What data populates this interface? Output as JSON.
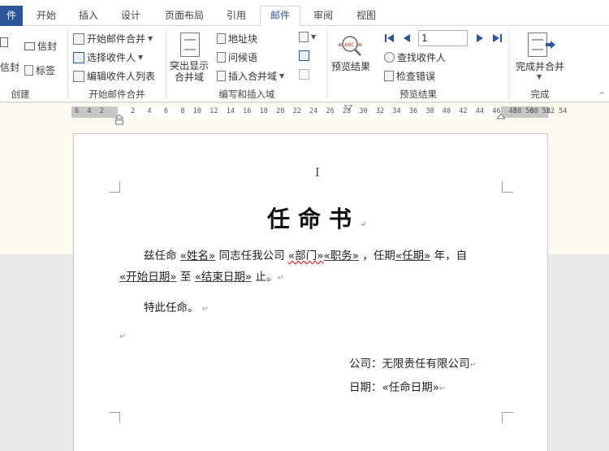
{
  "tabs": {
    "file": "件",
    "home": "开始",
    "insert": "插入",
    "design": "设计",
    "layout": "页面布局",
    "references": "引用",
    "mailings": "邮件",
    "review": "审阅",
    "view": "视图"
  },
  "ribbon": {
    "create": {
      "envelopes": "信封",
      "labels": "标签",
      "envelope_left": "信封",
      "group": "创建"
    },
    "start_merge": {
      "start": "开始邮件合并",
      "select_recipients": "选择收件人",
      "edit_list": "编辑收件人列表",
      "group": "开始邮件合并"
    },
    "write_insert": {
      "highlight_line1": "突出显示",
      "highlight_line2": "合并域",
      "address_block": "地址块",
      "greeting_line": "问候语",
      "insert_field": "插入合并域",
      "group": "编写和插入域"
    },
    "preview": {
      "preview_results": "预览结果",
      "record_number": "1",
      "find_recipient": "查找收件人",
      "check_errors": "检查错误",
      "group": "预览结果"
    },
    "finish": {
      "finish_merge": "完成并合并",
      "group": "完成"
    }
  },
  "ruler": {
    "left_numbers": "6  4  2",
    "numbers": "2   4   6   8  10  12  14  16  18  20  22  24  26  28  30  32  34  36  38  40  42  44  46  48  50  52  54",
    "right_numbers": "58  60  62"
  },
  "document": {
    "title": "任命书",
    "line1": {
      "a": "兹任命",
      "name": "«姓名»",
      "b": "同志任我公司",
      "dept": "«部门»",
      "job": "«职务»",
      "c": "，任期",
      "term": "«任期»",
      "d": "年，自"
    },
    "line2": {
      "start": "«开始日期»",
      "a": "至",
      "end": "«结束日期»",
      "b": "止。"
    },
    "line3": "特此任命。",
    "company_label": "公司：",
    "company_value": "无限责任有限公司",
    "date_label": "日期：",
    "date_value": "«任命日期»"
  }
}
